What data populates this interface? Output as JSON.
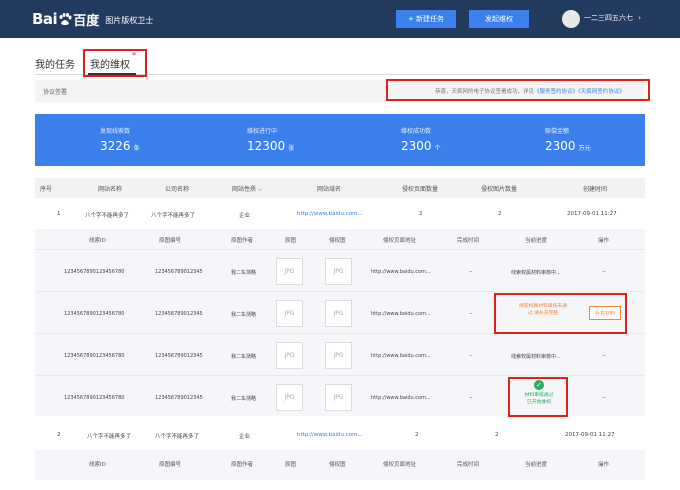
{
  "header": {
    "logo_bai": "Bai",
    "logo_du": "百度",
    "subtitle": "图片版权卫士",
    "new_task_label": "+ 新建任务",
    "initiate_label": "发起维权",
    "username": "一二三四五六七",
    "user_caret": "›"
  },
  "tabs": {
    "tasks": "我的任务",
    "rights": "我的维权",
    "asterisk": "*"
  },
  "agreement": {
    "label": "协议签署",
    "msg_prefix": "恭喜，天疯网的电子协议签署成功，详见",
    "link1": "《服务签约协议》",
    "link2": "《天疯网签约协议》"
  },
  "stats": [
    {
      "label": "发现线索数",
      "value": "3226",
      "unit": "条"
    },
    {
      "label": "维权进行中",
      "value": "12300",
      "unit": "张"
    },
    {
      "label": "维权成功数",
      "value": "2300",
      "unit": "个"
    },
    {
      "label": "赔偿金额",
      "value": "2300",
      "unit": "万元"
    }
  ],
  "table": {
    "headers": [
      "序号",
      "网站名称",
      "公司名称",
      "网站性质",
      "网站域名",
      "侵权页面数量",
      "侵权图片数量",
      "创建时间"
    ],
    "sort_caret": "⌵",
    "rows": [
      {
        "index": "1",
        "site": "八个字不能再多了",
        "company": "八个字不能再多了",
        "type": "企业",
        "domain": "http://www.baidu.com...",
        "pages": "2",
        "images": "2",
        "created": "2017-09-01 11:27"
      },
      {
        "index": "2",
        "site": "八个字不能再多了",
        "company": "八个字不能再多了",
        "type": "企业",
        "domain": "http://www.baidu.com...",
        "pages": "2",
        "images": "2",
        "created": "2017-09-01 11:27"
      }
    ]
  },
  "subtable": {
    "headers": [
      "线索ID",
      "原图编号",
      "原图作者",
      "原图",
      "侵权图",
      "侵权页面地址",
      "完成时间",
      "当前进度",
      "操作"
    ],
    "jpg": "JPG",
    "rows": [
      {
        "clue_id": "1234567890123456780",
        "orig_no": "12345678901​2345",
        "author": "我二车测略",
        "url": "http://www.baidu.com...",
        "done": "--",
        "progress": "线索权属材料审核中...",
        "action": "--"
      },
      {
        "clue_id": "1234567890123456780",
        "orig_no": "12345678901​2345",
        "author": "我二车测略",
        "url": "http://www.baidu.com...",
        "done": "--",
        "progress_line1": "线索权属材料审核未通",
        "progress_line2": "过,请补充完整",
        "action": "补充材料"
      },
      {
        "clue_id": "1234567890123456780",
        "orig_no": "12345678901​2345",
        "author": "我二车测略",
        "url": "http://www.baidu.com...",
        "done": "--",
        "progress": "线索权属材料审核中...",
        "action": "--"
      },
      {
        "clue_id": "1234567890123456780",
        "orig_no": "12345678901​2345",
        "author": "我二车测略",
        "url": "http://www.baidu.com...",
        "done": "--",
        "progress_line1": "材料审核通过",
        "progress_line2": "已开始维权",
        "action": "--"
      }
    ]
  }
}
